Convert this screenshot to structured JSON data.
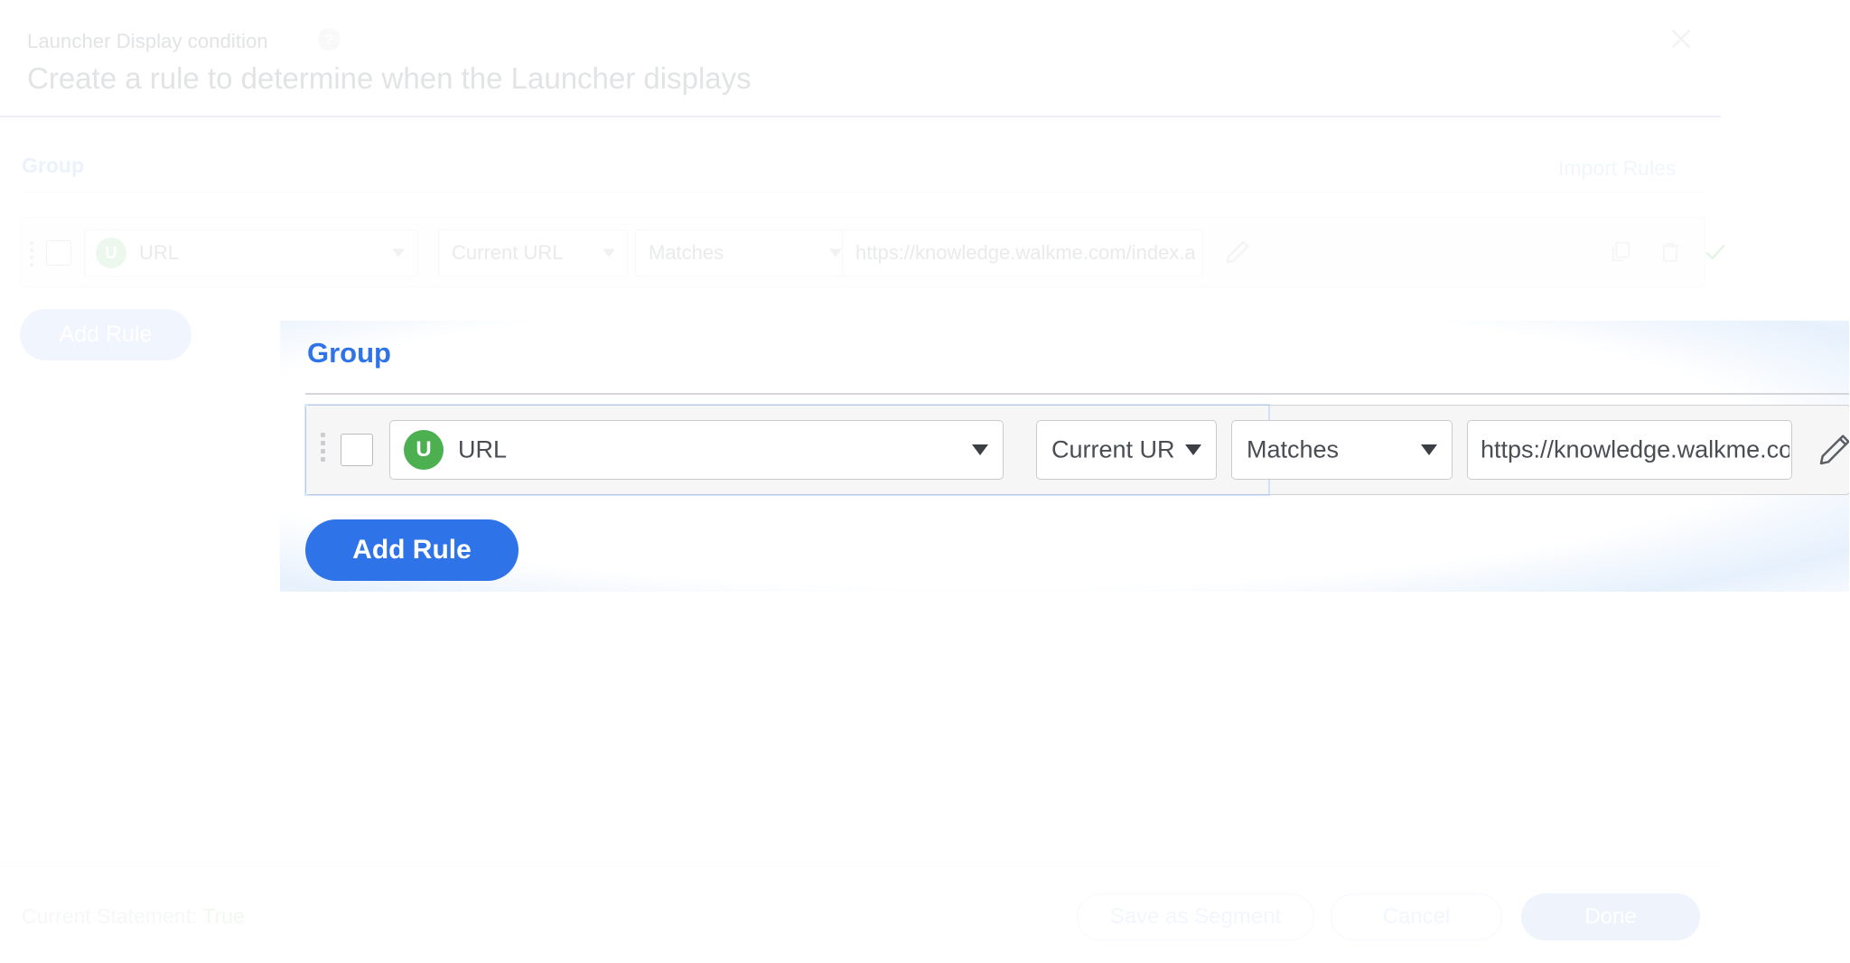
{
  "header": {
    "eyebrow": "Launcher Display condition",
    "help_icon": "?",
    "title": "Create a rule to determine when the Launcher displays",
    "close_icon": "close-icon"
  },
  "base_panel": {
    "group_label": "Group",
    "import_rules_label": "Import Rules",
    "add_rule_label": "Add Rule",
    "rule": {
      "type_badge": "U",
      "type_label": "URL",
      "source_label": "Current URL",
      "operator_label": "Matches",
      "value": "https://knowledge.walkme.com/index.ac",
      "edit_icon": "pencil-icon",
      "duplicate_icon": "copy-icon",
      "delete_icon": "trash-icon",
      "valid_icon": "check-icon"
    }
  },
  "highlight_panel": {
    "group_label": "Group",
    "add_rule_label": "Add Rule",
    "rule": {
      "type_badge": "U",
      "type_label": "URL",
      "source_label": "Current URL",
      "operator_label": "Matches",
      "value": "https://knowledge.walkme.com/index.ac",
      "edit_icon": "pencil-icon"
    }
  },
  "footer": {
    "statement_prefix": "Current Statement: ",
    "statement_value": "True",
    "save_as_segment_label": "Save as Segment",
    "cancel_label": "Cancel",
    "done_label": "Done"
  },
  "colors": {
    "accent_blue": "#2f73e8",
    "badge_green": "#4caf50",
    "true_green": "#cdeccf",
    "header_rule": "#cdbfe8"
  }
}
